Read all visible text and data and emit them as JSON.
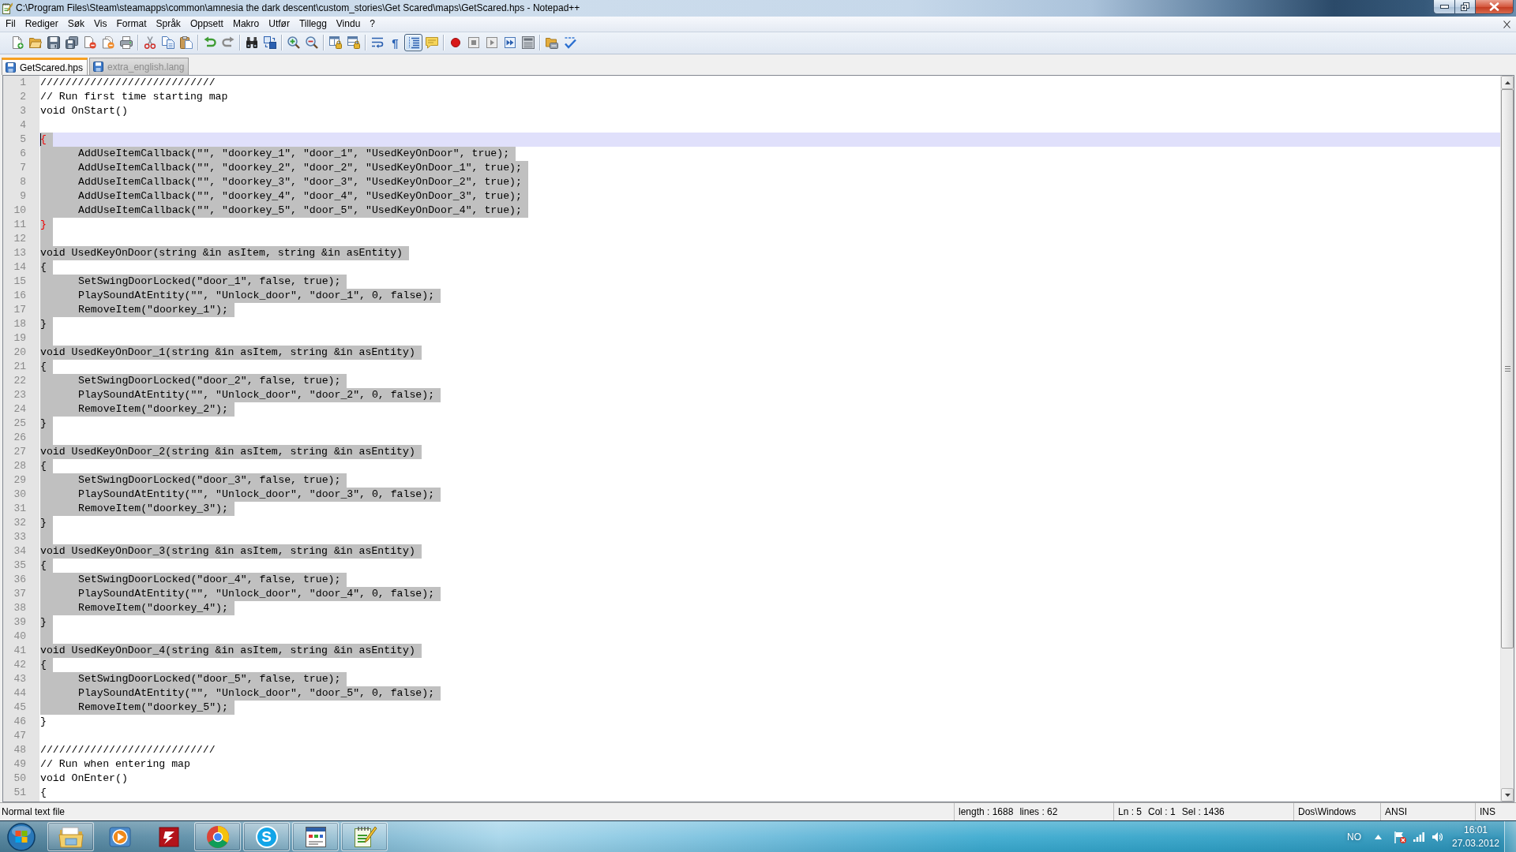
{
  "window": {
    "title": "C:\\Program Files\\Steam\\steamapps\\common\\amnesia the dark descent\\custom_stories\\Get Scared\\maps\\GetScared.hps - Notepad++"
  },
  "menu": [
    "Fil",
    "Rediger",
    "Søk",
    "Vis",
    "Format",
    "Språk",
    "Oppsett",
    "Makro",
    "Utfør",
    "Tillegg",
    "Vindu",
    "?"
  ],
  "toolbar": {
    "groups": [
      {
        "tools": [
          {
            "kind": "new",
            "pressed": false
          },
          {
            "kind": "open",
            "pressed": false
          },
          {
            "kind": "save",
            "pressed": false
          },
          {
            "kind": "saveall",
            "pressed": false
          },
          {
            "kind": "close",
            "pressed": false
          },
          {
            "kind": "closeall",
            "pressed": false
          },
          {
            "kind": "print",
            "pressed": false
          }
        ]
      },
      {
        "tools": [
          {
            "kind": "cut",
            "pressed": false
          },
          {
            "kind": "copy",
            "pressed": false
          },
          {
            "kind": "paste",
            "pressed": false
          }
        ]
      },
      {
        "tools": [
          {
            "kind": "undo",
            "pressed": false
          },
          {
            "kind": "redo",
            "pressed": false
          }
        ]
      },
      {
        "tools": [
          {
            "kind": "find",
            "pressed": false
          },
          {
            "kind": "replace",
            "pressed": false
          }
        ]
      },
      {
        "tools": [
          {
            "kind": "zoomin",
            "pressed": false
          },
          {
            "kind": "zoomout",
            "pressed": false
          }
        ]
      },
      {
        "tools": [
          {
            "kind": "syncv",
            "pressed": false
          },
          {
            "kind": "synch",
            "pressed": false
          }
        ]
      },
      {
        "tools": [
          {
            "kind": "wrap",
            "pressed": false
          },
          {
            "kind": "glyph",
            "text": "¶",
            "pressed": false
          },
          {
            "kind": "guides",
            "pressed": true
          },
          {
            "kind": "note",
            "pressed": false
          }
        ]
      },
      {
        "tools": [
          {
            "kind": "record",
            "pressed": false
          },
          {
            "kind": "stop",
            "pressed": false
          },
          {
            "kind": "play",
            "pressed": false
          },
          {
            "kind": "playmany",
            "pressed": false
          },
          {
            "kind": "savemacro",
            "pressed": false
          }
        ]
      },
      {
        "tools": [
          {
            "kind": "folderbox",
            "pressed": false
          },
          {
            "kind": "spell",
            "pressed": false
          }
        ]
      }
    ]
  },
  "tabs": [
    {
      "label": "GetScared.hps",
      "selected": true
    },
    {
      "label": "extra_english.lang",
      "selected": false
    }
  ],
  "editor": {
    "lines": [
      {
        "number": "1",
        "text": "////////////////////////////",
        "selected": false,
        "current": false,
        "brace_match": false
      },
      {
        "number": "2",
        "text": "// Run first time starting map",
        "selected": false,
        "current": false,
        "brace_match": false
      },
      {
        "number": "3",
        "text": "void OnStart()",
        "selected": false,
        "current": false,
        "brace_match": false
      },
      {
        "number": "4",
        "selected": false,
        "current": false
      },
      {
        "number": "5",
        "text": "{",
        "selected": true,
        "current": true,
        "brace_match": true
      },
      {
        "number": "6",
        "text": "\tAddUseItemCallback(\"\", \"doorkey_1\", \"door_1\", \"UsedKeyOnDoor\", true);",
        "selected": true,
        "current": false,
        "brace_match": false
      },
      {
        "number": "7",
        "text": "\tAddUseItemCallback(\"\", \"doorkey_2\", \"door_2\", \"UsedKeyOnDoor_1\", true);",
        "selected": true,
        "current": false,
        "brace_match": false
      },
      {
        "number": "8",
        "text": "\tAddUseItemCallback(\"\", \"doorkey_3\", \"door_3\", \"UsedKeyOnDoor_2\", true);",
        "selected": true,
        "current": false,
        "brace_match": false
      },
      {
        "number": "9",
        "text": "\tAddUseItemCallback(\"\", \"doorkey_4\", \"door_4\", \"UsedKeyOnDoor_3\", true);",
        "selected": true,
        "current": false,
        "brace_match": false
      },
      {
        "number": "10",
        "text": "\tAddUseItemCallback(\"\", \"doorkey_5\", \"door_5\", \"UsedKeyOnDoor_4\", true);",
        "selected": true,
        "current": false,
        "brace_match": false
      },
      {
        "number": "11",
        "text": "}",
        "selected": true,
        "current": false,
        "brace_match": true
      },
      {
        "number": "12",
        "selected": true,
        "current": false
      },
      {
        "number": "13",
        "text": "void UsedKeyOnDoor(string &in asItem, string &in asEntity)",
        "selected": true,
        "current": false,
        "brace_match": false
      },
      {
        "number": "14",
        "text": "{",
        "selected": true,
        "current": false,
        "brace_match": false
      },
      {
        "number": "15",
        "text": "\tSetSwingDoorLocked(\"door_1\", false, true);",
        "selected": true,
        "current": false,
        "brace_match": false
      },
      {
        "number": "16",
        "text": "\tPlaySoundAtEntity(\"\", \"Unlock_door\", \"door_1\", 0, false);",
        "selected": true,
        "current": false,
        "brace_match": false
      },
      {
        "number": "17",
        "text": "\tRemoveItem(\"doorkey_1\");",
        "selected": true,
        "current": false,
        "brace_match": false
      },
      {
        "number": "18",
        "text": "}",
        "selected": true,
        "current": false,
        "brace_match": false
      },
      {
        "number": "19",
        "selected": true,
        "current": false
      },
      {
        "number": "20",
        "text": "void UsedKeyOnDoor_1(string &in asItem, string &in asEntity)",
        "selected": true,
        "current": false,
        "brace_match": false
      },
      {
        "number": "21",
        "text": "{",
        "selected": true,
        "current": false,
        "brace_match": false
      },
      {
        "number": "22",
        "text": "\tSetSwingDoorLocked(\"door_2\", false, true);",
        "selected": true,
        "current": false,
        "brace_match": false
      },
      {
        "number": "23",
        "text": "\tPlaySoundAtEntity(\"\", \"Unlock_door\", \"door_2\", 0, false);",
        "selected": true,
        "current": false,
        "brace_match": false
      },
      {
        "number": "24",
        "text": "\tRemoveItem(\"doorkey_2\");",
        "selected": true,
        "current": false,
        "brace_match": false
      },
      {
        "number": "25",
        "text": "}",
        "selected": true,
        "current": false,
        "brace_match": false
      },
      {
        "number": "26",
        "selected": true,
        "current": false
      },
      {
        "number": "27",
        "text": "void UsedKeyOnDoor_2(string &in asItem, string &in asEntity)",
        "selected": true,
        "current": false,
        "brace_match": false
      },
      {
        "number": "28",
        "text": "{",
        "selected": true,
        "current": false,
        "brace_match": false
      },
      {
        "number": "29",
        "text": "\tSetSwingDoorLocked(\"door_3\", false, true);",
        "selected": true,
        "current": false,
        "brace_match": false
      },
      {
        "number": "30",
        "text": "\tPlaySoundAtEntity(\"\", \"Unlock_door\", \"door_3\", 0, false);",
        "selected": true,
        "current": false,
        "brace_match": false
      },
      {
        "number": "31",
        "text": "\tRemoveItem(\"doorkey_3\");",
        "selected": true,
        "current": false,
        "brace_match": false
      },
      {
        "number": "32",
        "text": "}",
        "selected": true,
        "current": false,
        "brace_match": false
      },
      {
        "number": "33",
        "selected": true,
        "current": false
      },
      {
        "number": "34",
        "text": "void UsedKeyOnDoor_3(string &in asItem, string &in asEntity)",
        "selected": true,
        "current": false,
        "brace_match": false
      },
      {
        "number": "35",
        "text": "{",
        "selected": true,
        "current": false,
        "brace_match": false
      },
      {
        "number": "36",
        "text": "\tSetSwingDoorLocked(\"door_4\", false, true);",
        "selected": true,
        "current": false,
        "brace_match": false
      },
      {
        "number": "37",
        "text": "\tPlaySoundAtEntity(\"\", \"Unlock_door\", \"door_4\", 0, false);",
        "selected": true,
        "current": false,
        "brace_match": false
      },
      {
        "number": "38",
        "text": "\tRemoveItem(\"doorkey_4\");",
        "selected": true,
        "current": false,
        "brace_match": false
      },
      {
        "number": "39",
        "text": "}",
        "selected": true,
        "current": false,
        "brace_match": false
      },
      {
        "number": "40",
        "selected": true,
        "current": false
      },
      {
        "number": "41",
        "text": "void UsedKeyOnDoor_4(string &in asItem, string &in asEntity)",
        "selected": true,
        "current": false,
        "brace_match": false
      },
      {
        "number": "42",
        "text": "{",
        "selected": true,
        "current": false,
        "brace_match": false
      },
      {
        "number": "43",
        "text": "\tSetSwingDoorLocked(\"door_5\", false, true);",
        "selected": true,
        "current": false,
        "brace_match": false
      },
      {
        "number": "44",
        "text": "\tPlaySoundAtEntity(\"\", \"Unlock_door\", \"door_5\", 0, false);",
        "selected": true,
        "current": false,
        "brace_match": false
      },
      {
        "number": "45",
        "text": "\tRemoveItem(\"doorkey_5\");",
        "selected": true,
        "current": false,
        "brace_match": false
      },
      {
        "number": "46",
        "text": "}",
        "selected": false,
        "current": false,
        "brace_match": false
      },
      {
        "number": "47",
        "selected": false,
        "current": false
      },
      {
        "number": "48",
        "text": "////////////////////////////",
        "selected": false,
        "current": false,
        "brace_match": false
      },
      {
        "number": "49",
        "text": "// Run when entering map",
        "selected": false,
        "current": false,
        "brace_match": false
      },
      {
        "number": "50",
        "text": "void OnEnter()",
        "selected": false,
        "current": false,
        "brace_match": false
      },
      {
        "number": "51",
        "text": "{",
        "selected": false,
        "current": false,
        "brace_match": false
      }
    ]
  },
  "status_bar": {
    "sections": [
      {
        "texts": [
          "Normal text file"
        ]
      },
      {
        "texts": [
          "length : 1688",
          "lines : 62"
        ]
      },
      {
        "texts": [
          "Ln : 5",
          "Col : 1",
          "Sel : 1436"
        ]
      },
      {
        "texts": [
          "Dos\\Windows"
        ]
      },
      {
        "texts": [
          "ANSI"
        ]
      },
      {
        "texts": [
          "INS"
        ]
      }
    ]
  },
  "taskbar": {
    "apps": [
      {
        "kind": "folders",
        "running": true
      },
      {
        "kind": "media",
        "running": false
      },
      {
        "kind": "bolt",
        "running": false
      },
      {
        "kind": "wheel",
        "running": true
      },
      {
        "kind": "letter",
        "text": "S",
        "running": true
      },
      {
        "kind": "window",
        "running": true
      },
      {
        "kind": "notepad",
        "running": true
      }
    ],
    "tray": {
      "language": "NO",
      "time": "16:01",
      "date": "27.03.2012"
    }
  }
}
